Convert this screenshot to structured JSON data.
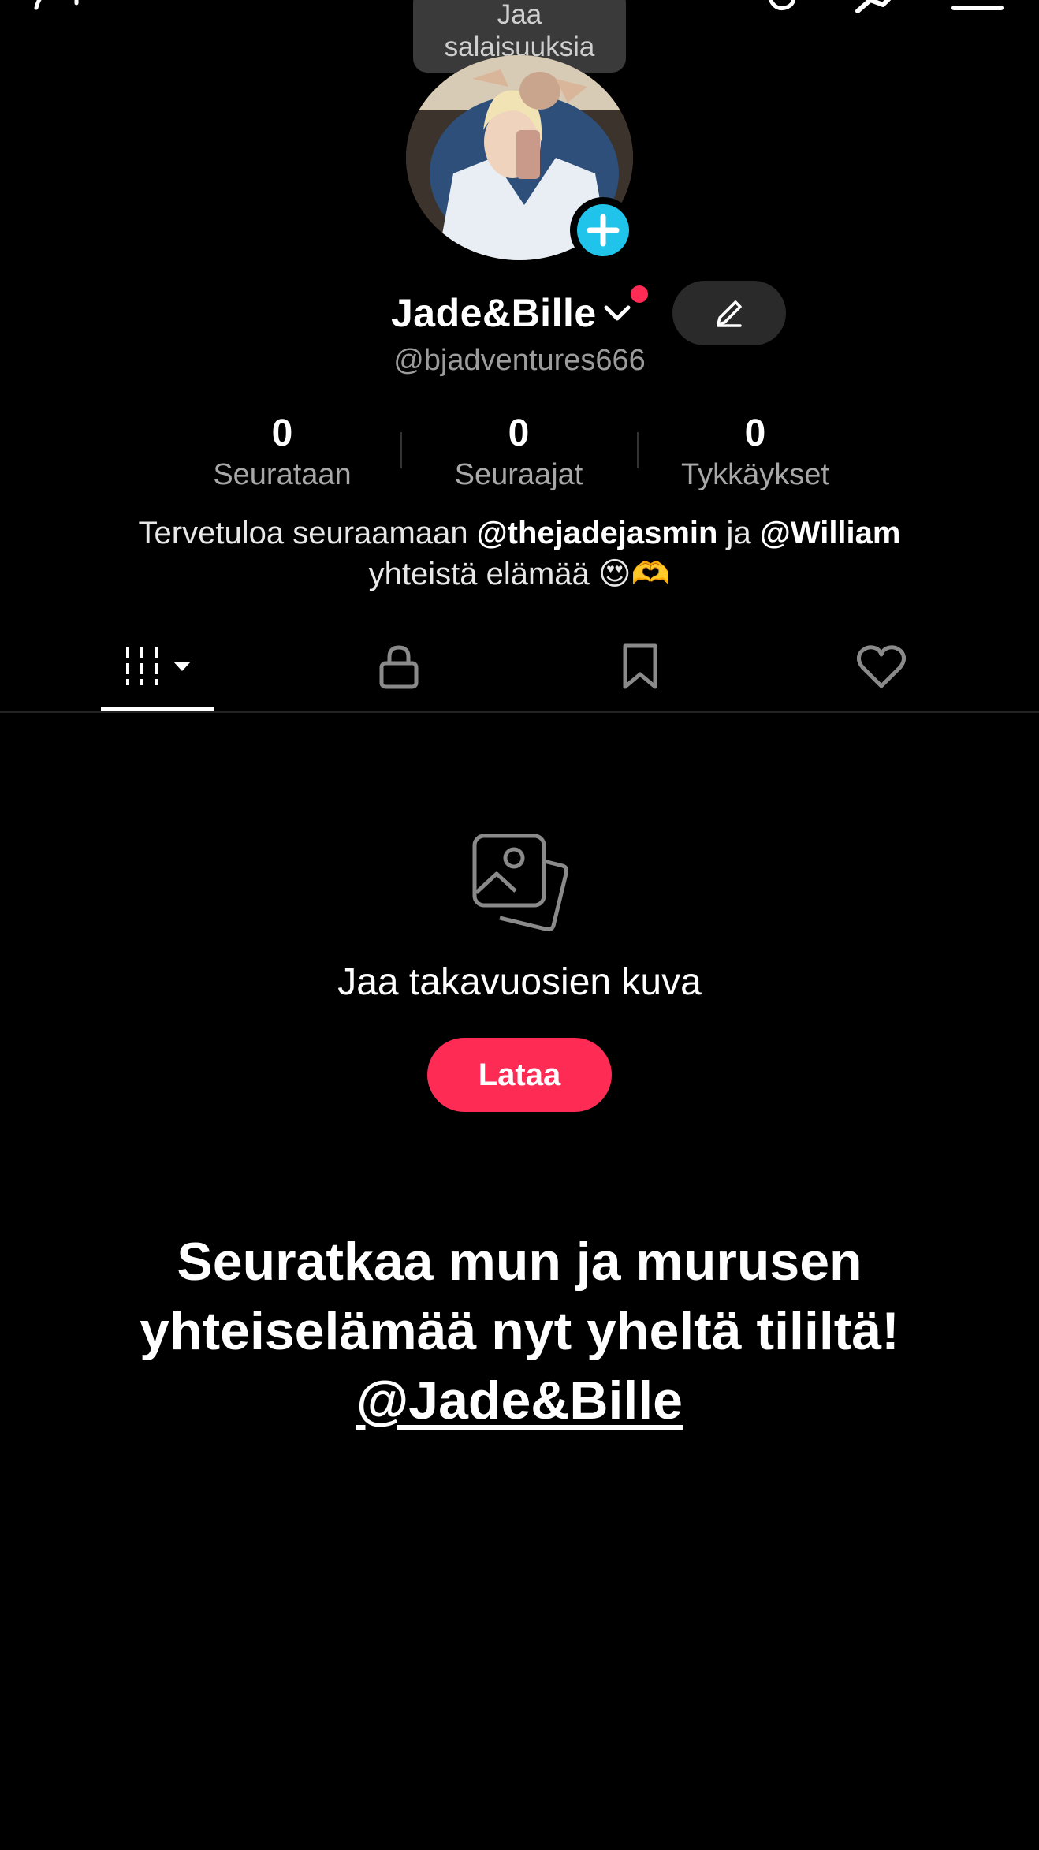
{
  "tooltip": {
    "text_line1": "Jaa",
    "text_line2": "salaisuuksia"
  },
  "profile": {
    "display_name": "Jade&Bille",
    "handle": "@bjadventures666",
    "notification_color": "#fe2c55"
  },
  "stats": [
    {
      "value": "0",
      "label": "Seurataan"
    },
    {
      "value": "0",
      "label": "Seuraajat"
    },
    {
      "value": "0",
      "label": "Tykkäykset"
    }
  ],
  "bio": {
    "part1": "Tervetuloa seuraamaan ",
    "mention1": "@thejadejasmin",
    "part2": " ja ",
    "mention2": "@William",
    "line2": "yhteistä elämää 😍🫶"
  },
  "tabs": [
    {
      "icon": "grid-icon",
      "active": true
    },
    {
      "icon": "lock-icon",
      "active": false
    },
    {
      "icon": "bookmark-icon",
      "active": false
    },
    {
      "icon": "heart-icon",
      "active": false
    }
  ],
  "empty_state": {
    "title": "Jaa takavuosien kuva",
    "button_label": "Lataa",
    "button_color": "#fe2c55"
  },
  "overlay_text": {
    "line1": "Seuratkaa mun ja murusen",
    "line2": "yhteiselämää nyt yheltä tililtä!",
    "mention": "@Jade&Bille"
  },
  "accent_colors": {
    "add_badge": "#20c4ea",
    "primary": "#fe2c55"
  }
}
